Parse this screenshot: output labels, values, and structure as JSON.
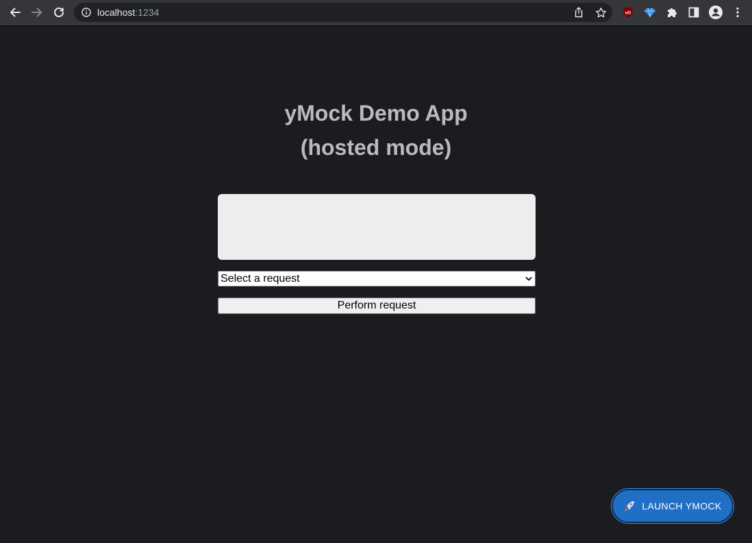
{
  "browser": {
    "url_host": "localhost",
    "url_port": ":1234",
    "icons": {
      "back": "back-arrow-icon",
      "forward": "forward-arrow-icon",
      "reload": "reload-icon",
      "info": "info-icon",
      "share": "share-icon",
      "bookmark": "star-icon",
      "ublock": "ublock-icon",
      "gem": "gem-extension-icon",
      "extensions": "puzzle-icon",
      "sidepanel": "side-panel-icon",
      "profile": "profile-icon",
      "menu": "kebab-menu-icon"
    }
  },
  "page": {
    "title_line1": "yMock Demo App",
    "title_line2": "(hosted mode)",
    "output_value": "",
    "select": {
      "selected": "Select a request"
    },
    "perform_label": "Perform request",
    "launch_label": "LAUNCH YMOCK",
    "launch_icon": "rocket-icon"
  },
  "colors": {
    "background": "#1b1c20",
    "title": "#b9bbbe",
    "launch_button": "#1f6fc6",
    "output_box": "#ededed"
  }
}
